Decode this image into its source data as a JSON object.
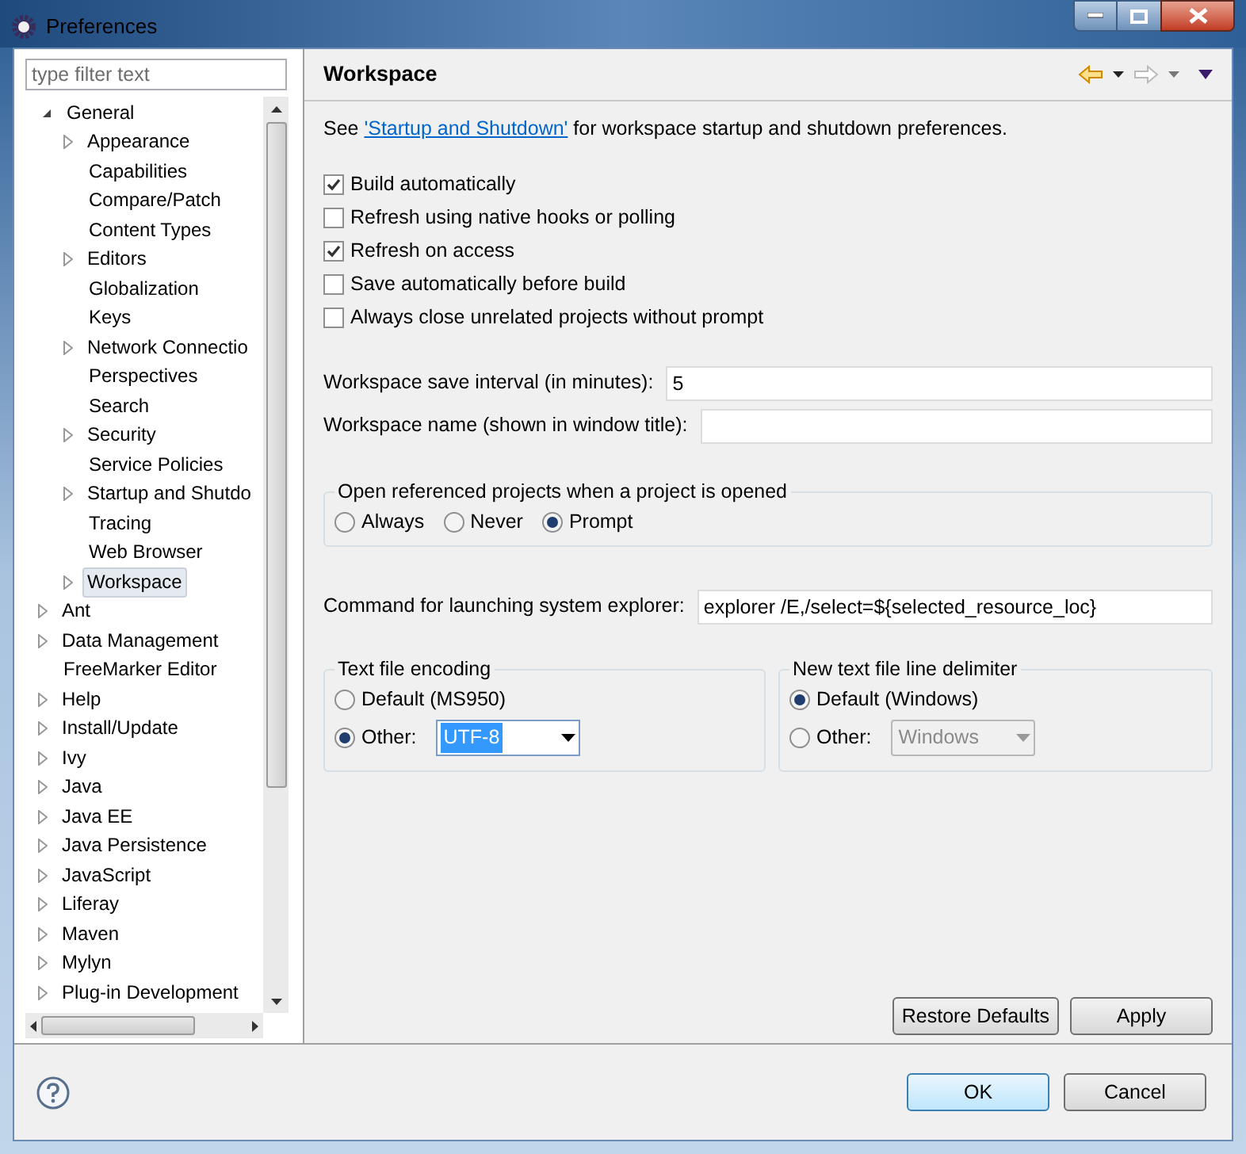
{
  "window": {
    "title": "Preferences"
  },
  "filter": {
    "placeholder": "type filter text"
  },
  "tree": [
    {
      "label": "General",
      "kind": "open",
      "selected": false,
      "children": [
        {
          "label": "Appearance",
          "kind": "closed",
          "selected": false
        },
        {
          "label": "Capabilities",
          "kind": "none",
          "selected": false
        },
        {
          "label": "Compare/Patch",
          "kind": "none",
          "selected": false
        },
        {
          "label": "Content Types",
          "kind": "none",
          "selected": false
        },
        {
          "label": "Editors",
          "kind": "closed",
          "selected": false
        },
        {
          "label": "Globalization",
          "kind": "none",
          "selected": false
        },
        {
          "label": "Keys",
          "kind": "none",
          "selected": false
        },
        {
          "label": "Network Connectio",
          "kind": "closed",
          "selected": false
        },
        {
          "label": "Perspectives",
          "kind": "none",
          "selected": false
        },
        {
          "label": "Search",
          "kind": "none",
          "selected": false
        },
        {
          "label": "Security",
          "kind": "closed",
          "selected": false
        },
        {
          "label": "Service Policies",
          "kind": "none",
          "selected": false
        },
        {
          "label": "Startup and Shutdo",
          "kind": "closed",
          "selected": false
        },
        {
          "label": "Tracing",
          "kind": "none",
          "selected": false
        },
        {
          "label": "Web Browser",
          "kind": "none",
          "selected": false
        },
        {
          "label": "Workspace",
          "kind": "closed",
          "selected": true
        }
      ]
    },
    {
      "label": "Ant",
      "kind": "closed",
      "selected": false
    },
    {
      "label": "Data Management",
      "kind": "closed",
      "selected": false
    },
    {
      "label": "FreeMarker Editor",
      "kind": "none",
      "selected": false
    },
    {
      "label": "Help",
      "kind": "closed",
      "selected": false
    },
    {
      "label": "Install/Update",
      "kind": "closed",
      "selected": false
    },
    {
      "label": "Ivy",
      "kind": "closed",
      "selected": false
    },
    {
      "label": "Java",
      "kind": "closed",
      "selected": false
    },
    {
      "label": "Java EE",
      "kind": "closed",
      "selected": false
    },
    {
      "label": "Java Persistence",
      "kind": "closed",
      "selected": false
    },
    {
      "label": "JavaScript",
      "kind": "closed",
      "selected": false
    },
    {
      "label": "Liferay",
      "kind": "closed",
      "selected": false
    },
    {
      "label": "Maven",
      "kind": "closed",
      "selected": false
    },
    {
      "label": "Mylyn",
      "kind": "closed",
      "selected": false
    },
    {
      "label": "Plug-in Development",
      "kind": "closed",
      "selected": false
    }
  ],
  "page": {
    "title": "Workspace",
    "nav": {
      "back_enabled": true,
      "forward_enabled": false
    },
    "intro": {
      "before": "See ",
      "link": "'Startup and Shutdown'",
      "after": " for workspace startup and shutdown preferences."
    },
    "checkboxes": [
      {
        "label": "Build automatically",
        "checked": true
      },
      {
        "label": "Refresh using native hooks or polling",
        "checked": false
      },
      {
        "label": "Refresh on access",
        "checked": true
      },
      {
        "label": "Save automatically before build",
        "checked": false
      },
      {
        "label": "Always close unrelated projects without prompt",
        "checked": false
      }
    ],
    "fields": [
      {
        "label": "Workspace save interval (in minutes):",
        "value": "5"
      },
      {
        "label": "Workspace name (shown in window title):"
      }
    ],
    "open_projects": {
      "title": "Open referenced projects when a project is opened",
      "options": [
        {
          "label": "Always",
          "selected": false
        },
        {
          "label": "Never",
          "selected": false
        },
        {
          "label": "Prompt",
          "selected": true
        }
      ]
    },
    "command": {
      "label": "Command for launching system explorer:",
      "value": "explorer /E,/select=${selected_resource_loc}"
    },
    "encoding": {
      "title": "Text file encoding",
      "options": [
        {
          "label": "Default (MS950)",
          "selected": false
        },
        {
          "label": "Other:",
          "selected": true
        }
      ],
      "dropdown": {
        "value": "UTF-8",
        "disabled": false
      }
    },
    "delimiter": {
      "title": "New text file line delimiter",
      "options": [
        {
          "label": "Default (Windows)",
          "selected": true
        },
        {
          "label": "Other:",
          "selected": false
        }
      ],
      "dropdown": {
        "value": "Windows",
        "disabled": true
      }
    },
    "buttons": [
      "Restore Defaults",
      "Apply"
    ]
  },
  "footer": {
    "buttons": [
      {
        "label": "OK",
        "default": true
      },
      {
        "label": "Cancel",
        "default": false
      }
    ]
  }
}
